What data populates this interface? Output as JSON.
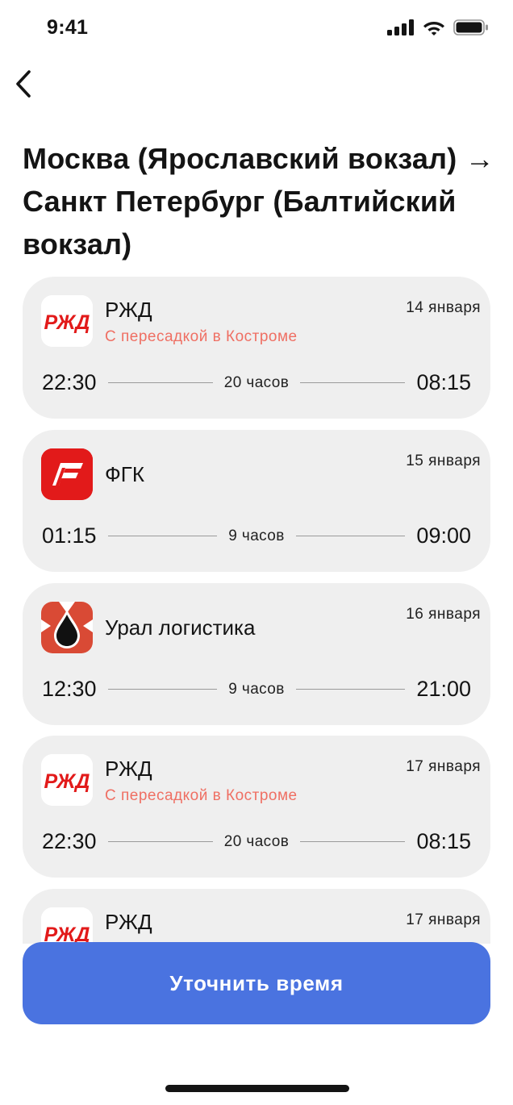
{
  "status_bar": {
    "time": "9:41"
  },
  "nav": {
    "back_icon": "chevron-left-icon"
  },
  "page": {
    "title": "Москва (Ярославский вокзал) → Санкт Петербург (Балтийский вокзал)"
  },
  "trips": [
    {
      "carrier": "РЖД",
      "logo": "rzd-logo",
      "transfer": "С пересадкой в Костроме",
      "date": "14 января",
      "departure": "22:30",
      "duration": "20 часов",
      "arrival": "08:15"
    },
    {
      "carrier": "ФГК",
      "logo": "fgk-logo",
      "transfer": "",
      "date": "15 января",
      "departure": "01:15",
      "duration": "9 часов",
      "arrival": "09:00"
    },
    {
      "carrier": "Урал логистика",
      "logo": "ural-logistika-logo",
      "transfer": "",
      "date": "16 января",
      "departure": "12:30",
      "duration": "9 часов",
      "arrival": "21:00"
    },
    {
      "carrier": "РЖД",
      "logo": "rzd-logo",
      "transfer": "С пересадкой в Костроме",
      "date": "17 января",
      "departure": "22:30",
      "duration": "20 часов",
      "arrival": "08:15"
    },
    {
      "carrier": "РЖД",
      "logo": "rzd-logo",
      "transfer": "",
      "date": "17 января",
      "departure": "",
      "duration": "",
      "arrival": ""
    }
  ],
  "cta": {
    "label": "Уточнить время"
  },
  "colors": {
    "accent": "#4a73e0",
    "transfer": "#ef6f63",
    "card": "#efefef",
    "rzd_red": "#e21a1a"
  }
}
